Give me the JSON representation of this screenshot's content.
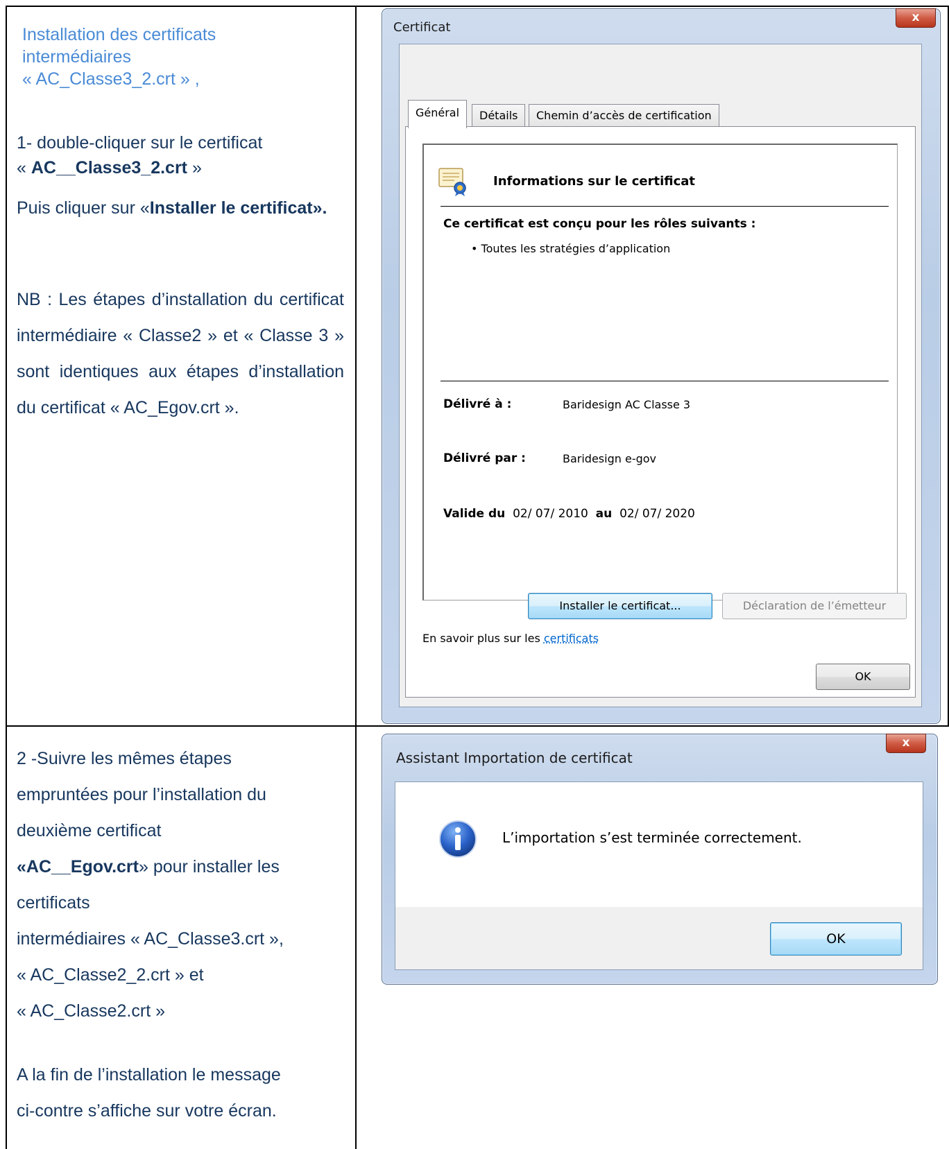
{
  "left": {
    "intro": [
      "Installation des certificats",
      "intermédiaires",
      "« AC_Classe3_2.crt » ,"
    ],
    "step1_line1": "1- double-cliquer sur le certificat",
    "step1_line2_prefix": "« ",
    "step1_line2_bold": "AC__Classe3_2.crt",
    "step1_line2_suffix": " »",
    "step1_action_prefix": "Puis cliquer sur «",
    "step1_action_bold": "Installer le certificat",
    "step1_action_suffix": "».",
    "nb": "NB : Les étapes d’installation du certificat intermédiaire « Classe2 » et « Classe 3 » sont identiques aux étapes d’installation du certificat « AC_Egov.crt ».",
    "step2_lines": [
      "2 -Suivre les mêmes étapes",
      "empruntées pour l’installation du",
      "deuxième certificat"
    ],
    "step2_bold_prefix": "«",
    "step2_bold": "AC__Egov.crt",
    "step2_bold_suffix": "» pour installer les",
    "step2_rest": [
      "certificats",
      "intermédiaires « AC_Classe3.crt »,",
      "« AC_Classe2_2.crt » et",
      "« AC_Classe2.crt »"
    ],
    "final": [
      "A la fin de l’installation le message",
      "ci-contre s’affiche sur votre écran."
    ]
  },
  "cert_dialog": {
    "title": "Certificat",
    "close": "x",
    "tabs": [
      "Général",
      "Détails",
      "Chemin d’accès de certification"
    ],
    "info_heading": "Informations sur le certificat",
    "roles_heading": "Ce certificat est conçu pour les rôles suivants :",
    "roles": [
      "• Toutes les stratégies d’application"
    ],
    "issued_to_label": "Délivré à :",
    "issued_to_value": "Baridesign AC Classe 3",
    "issued_by_label": "Délivré par :",
    "issued_by_value": "Baridesign e-gov",
    "valid_from_label": "Valide du",
    "valid_from": "02/ 07/ 2010",
    "valid_to_label": "au",
    "valid_to": "02/ 07/ 2020",
    "install_button": "Installer le certificat...",
    "issuer_statement_button": "Déclaration de l’émetteur",
    "learn_more_prefix": "En savoir plus sur les ",
    "learn_more_link": "certificats",
    "ok": "OK"
  },
  "import_dialog": {
    "title": "Assistant Importation de certificat",
    "close": "x",
    "message": "L’importation s’est terminée correctement.",
    "ok": "OK"
  },
  "colors": {
    "intro": "#4a8bd6",
    "body_text": "#17375e",
    "link": "#0066cc"
  },
  "icons": [
    "certificate-icon",
    "info-icon"
  ]
}
